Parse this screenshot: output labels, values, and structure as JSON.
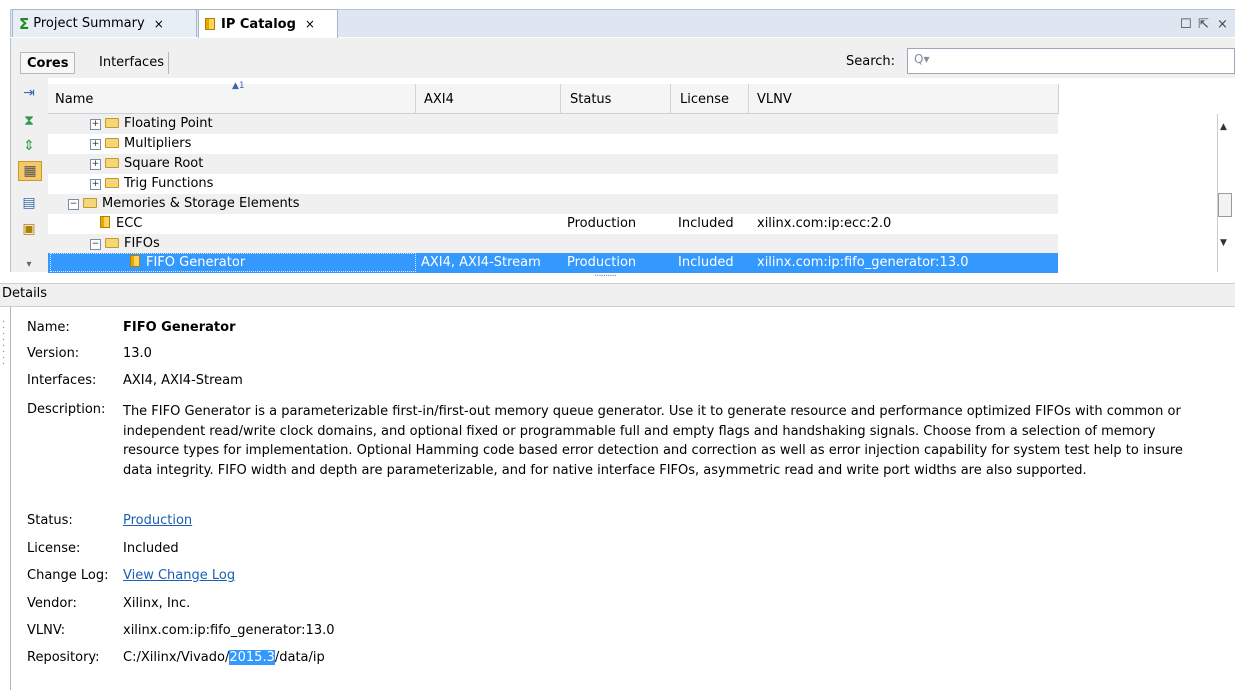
{
  "tabs": [
    {
      "label": "Project Summary",
      "icon": "sigma-icon",
      "close": "×"
    },
    {
      "label": "IP Catalog",
      "icon": "ip-chip-icon",
      "close": "×"
    }
  ],
  "window_controls": {
    "maximize": "☐",
    "float": "⇱",
    "close": "×"
  },
  "toolbar": {
    "cores_label": "Cores",
    "interfaces_label": "Interfaces",
    "search_label": "Search:",
    "search_value": "",
    "search_icon": "Q▾"
  },
  "table": {
    "sort_indicator": "▲1",
    "columns": [
      "Name",
      "AXI4",
      "Status",
      "License",
      "VLNV"
    ],
    "rows": [
      {
        "name": "Floating Point",
        "type": "folder",
        "toggle": "+",
        "axi4": "",
        "status": "",
        "license": "",
        "vlnv": ""
      },
      {
        "name": "Multipliers",
        "type": "folder",
        "toggle": "+",
        "axi4": "",
        "status": "",
        "license": "",
        "vlnv": ""
      },
      {
        "name": "Square Root",
        "type": "folder",
        "toggle": "+",
        "axi4": "",
        "status": "",
        "license": "",
        "vlnv": ""
      },
      {
        "name": "Trig Functions",
        "type": "folder",
        "toggle": "+",
        "axi4": "",
        "status": "",
        "license": "",
        "vlnv": ""
      },
      {
        "name": "Memories & Storage Elements",
        "type": "folder",
        "toggle": "−",
        "axi4": "",
        "status": "",
        "license": "",
        "vlnv": ""
      },
      {
        "name": "ECC",
        "type": "ip",
        "toggle": "",
        "axi4": "",
        "status": "Production",
        "license": "Included",
        "vlnv": "xilinx.com:ip:ecc:2.0"
      },
      {
        "name": "FIFOs",
        "type": "folder",
        "toggle": "−",
        "axi4": "",
        "status": "",
        "license": "",
        "vlnv": ""
      },
      {
        "name": "FIFO Generator",
        "type": "ip",
        "toggle": "",
        "axi4": "AXI4, AXI4-Stream",
        "status": "Production",
        "license": "Included",
        "vlnv": "xilinx.com:ip:fifo_generator:13.0"
      }
    ]
  },
  "details": {
    "header": "Details",
    "labels": {
      "name": "Name:",
      "version": "Version:",
      "interfaces": "Interfaces:",
      "description": "Description:",
      "status": "Status:",
      "license": "License:",
      "changelog": "Change Log:",
      "vendor": "Vendor:",
      "vlnv": "VLNV:",
      "repository": "Repository:"
    },
    "name": "FIFO Generator",
    "version": "13.0",
    "interfaces": "AXI4, AXI4-Stream",
    "description": "The FIFO Generator is a parameterizable first-in/first-out memory queue generator. Use it to generate resource and performance optimized FIFOs with common or independent read/write clock domains, and optional fixed or programmable full and empty flags and handshaking signals.  Choose from a selection of memory resource types for implementation.  Optional Hamming code based error detection and correction as well as error injection capability for system test help to insure data integrity.  FIFO width and depth are parameterizable, and for native interface FIFOs, asymmetric read and write port widths are also supported.",
    "status": "Production",
    "license": "Included",
    "changelog": "View Change Log",
    "vendor": "Xilinx, Inc.",
    "vlnv": "xilinx.com:ip:fifo_generator:13.0",
    "repository_prefix": "C:/Xilinx/Vivado/",
    "repository_highlight": "2015.3",
    "repository_suffix": "/data/ip"
  },
  "colors": {
    "selection": "#3399ff",
    "link": "#1a5fb4",
    "tab_bar": "#dde6f1"
  }
}
